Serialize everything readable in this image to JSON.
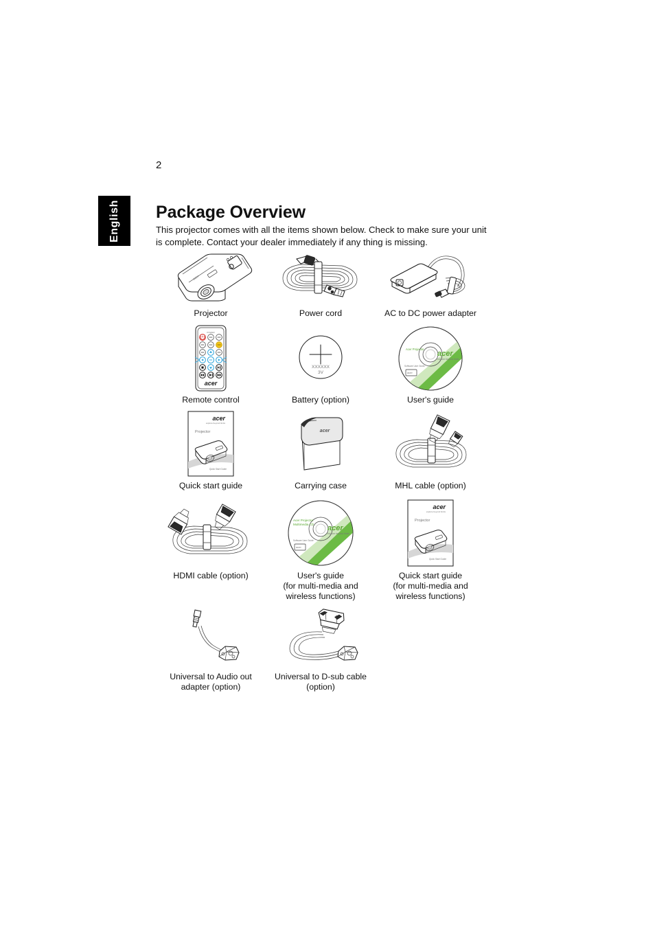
{
  "page": {
    "number": "2",
    "language_tab": "English",
    "title": "Package Overview",
    "intro": "This projector comes with all the items shown below. Check to make sure your unit is complete. Contact your dealer immediately if any thing is missing."
  },
  "brand": {
    "logo_text": "acer",
    "logo_tagline": "explore beyond limits",
    "accent_green": "#5aa832",
    "accent_blue": "#29a3dc",
    "accent_yellow": "#f0c419",
    "accent_red": "#d4322c"
  },
  "items": [
    [
      {
        "id": "projector",
        "caption": "Projector",
        "icon": "projector-illustration"
      },
      {
        "id": "power-cord",
        "caption": "Power cord",
        "icon": "power-cord-illustration"
      },
      {
        "id": "ac-dc-adapter",
        "caption": "AC to DC power adapter",
        "icon": "ac-adapter-illustration"
      }
    ],
    [
      {
        "id": "remote-control",
        "caption": "Remote control",
        "icon": "remote-control-illustration"
      },
      {
        "id": "battery",
        "caption": "Battery (option)",
        "icon": "coin-battery-illustration",
        "battery_code": "XXXXXX",
        "battery_voltage": "3V"
      },
      {
        "id": "users-guide",
        "caption": "User's guide",
        "icon": "cd-disc-illustration",
        "disc_label": "Acer Projector"
      }
    ],
    [
      {
        "id": "quick-start-guide",
        "caption": "Quick start guide",
        "icon": "booklet-illustration",
        "booklet_title": "Projector",
        "booklet_footer": "Quick start Guide"
      },
      {
        "id": "carrying-case",
        "caption": "Carrying case",
        "icon": "carrying-case-illustration"
      },
      {
        "id": "mhl-cable",
        "caption": "MHL cable (option)",
        "icon": "mhl-cable-illustration"
      }
    ],
    [
      {
        "id": "hdmi-cable",
        "caption": "HDMI cable (option)",
        "icon": "hdmi-cable-illustration"
      },
      {
        "id": "users-guide-mm",
        "caption": "User's guide\n(for multi-media and\nwireless functions)",
        "icon": "cd-disc-illustration",
        "disc_label": "Acer Projector\nMultimedia CD"
      },
      {
        "id": "quick-start-guide-mm",
        "caption": "Quick start guide\n(for multi-media and\nwireless functions)",
        "icon": "booklet-illustration",
        "booklet_title": "Projector",
        "booklet_footer": "Quick Start Guide"
      }
    ],
    [
      {
        "id": "universal-audio-out-adapter",
        "caption": "Universal to Audio out\nadapter (option)",
        "icon": "audio-out-adapter-illustration"
      },
      {
        "id": "universal-dsub-cable",
        "caption": "Universal to D-sub cable\n(option)",
        "icon": "dsub-cable-illustration"
      },
      {
        "id": "empty-slot",
        "caption": "",
        "icon": "none"
      }
    ]
  ]
}
